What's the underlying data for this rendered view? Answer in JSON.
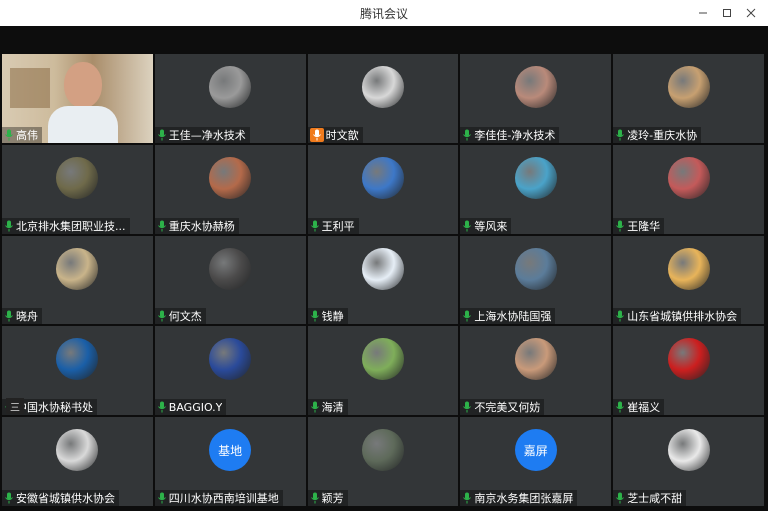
{
  "window": {
    "title": "腾讯会议"
  },
  "participants": [
    {
      "name": "高伟",
      "avatar": "video",
      "color": "#8a6a4a"
    },
    {
      "name": "王佳—净水技术",
      "avatar": "photo",
      "color": "#9a9a9a"
    },
    {
      "name": "时文歆",
      "avatar": "photo",
      "color": "#d8d8d8",
      "speaking": true
    },
    {
      "name": "李佳佳-净水技术",
      "avatar": "photo",
      "color": "#b98a7a"
    },
    {
      "name": "凌玲-重庆水协",
      "avatar": "photo",
      "color": "#c7a071"
    },
    {
      "name": "北京排水集团职业技...",
      "avatar": "photo",
      "color": "#6f6a4a"
    },
    {
      "name": "重庆水协赫杨",
      "avatar": "photo",
      "color": "#b46a4a"
    },
    {
      "name": "王利平",
      "avatar": "photo",
      "color": "#3d78c8"
    },
    {
      "name": "等风来",
      "avatar": "photo",
      "color": "#4aa3c9"
    },
    {
      "name": "王隆华",
      "avatar": "photo",
      "color": "#c45a5a"
    },
    {
      "name": "晓舟",
      "avatar": "photo",
      "color": "#c9b48a"
    },
    {
      "name": "何文杰",
      "avatar": "photo",
      "color": "#4b4a4a"
    },
    {
      "name": "钱静",
      "avatar": "photo",
      "color": "#e6eef6"
    },
    {
      "name": "上海水协陆国强",
      "avatar": "photo",
      "color": "#5b7c9a"
    },
    {
      "name": "山东省城镇供排水协会",
      "avatar": "photo",
      "color": "#e8b45a"
    },
    {
      "name": "中国水协秘书处",
      "avatar": "photo",
      "color": "#1a5fa8"
    },
    {
      "name": "BAGGIO.Y",
      "avatar": "photo",
      "color": "#2a4a9a"
    },
    {
      "name": "海清",
      "avatar": "photo",
      "color": "#7fae5a"
    },
    {
      "name": "不完美又何妨",
      "avatar": "photo",
      "color": "#c99a7a"
    },
    {
      "name": "崔福义",
      "avatar": "photo",
      "color": "#cc1f1f"
    },
    {
      "name": "安徽省城镇供水协会",
      "avatar": "photo",
      "color": "#d9d9d9"
    },
    {
      "name": "四川水协西南培训基地",
      "avatar": "text",
      "text": "基地",
      "color": "#1e7cf2"
    },
    {
      "name": "颖芳",
      "avatar": "photo",
      "color": "#5e6a5a"
    },
    {
      "name": "南京水务集团张嘉屏",
      "avatar": "text",
      "text": "嘉屏",
      "color": "#1e7cf2"
    },
    {
      "name": "芝士咸不甜",
      "avatar": "photo",
      "color": "#e9e9e9"
    }
  ],
  "screen_share_indicator": "三"
}
